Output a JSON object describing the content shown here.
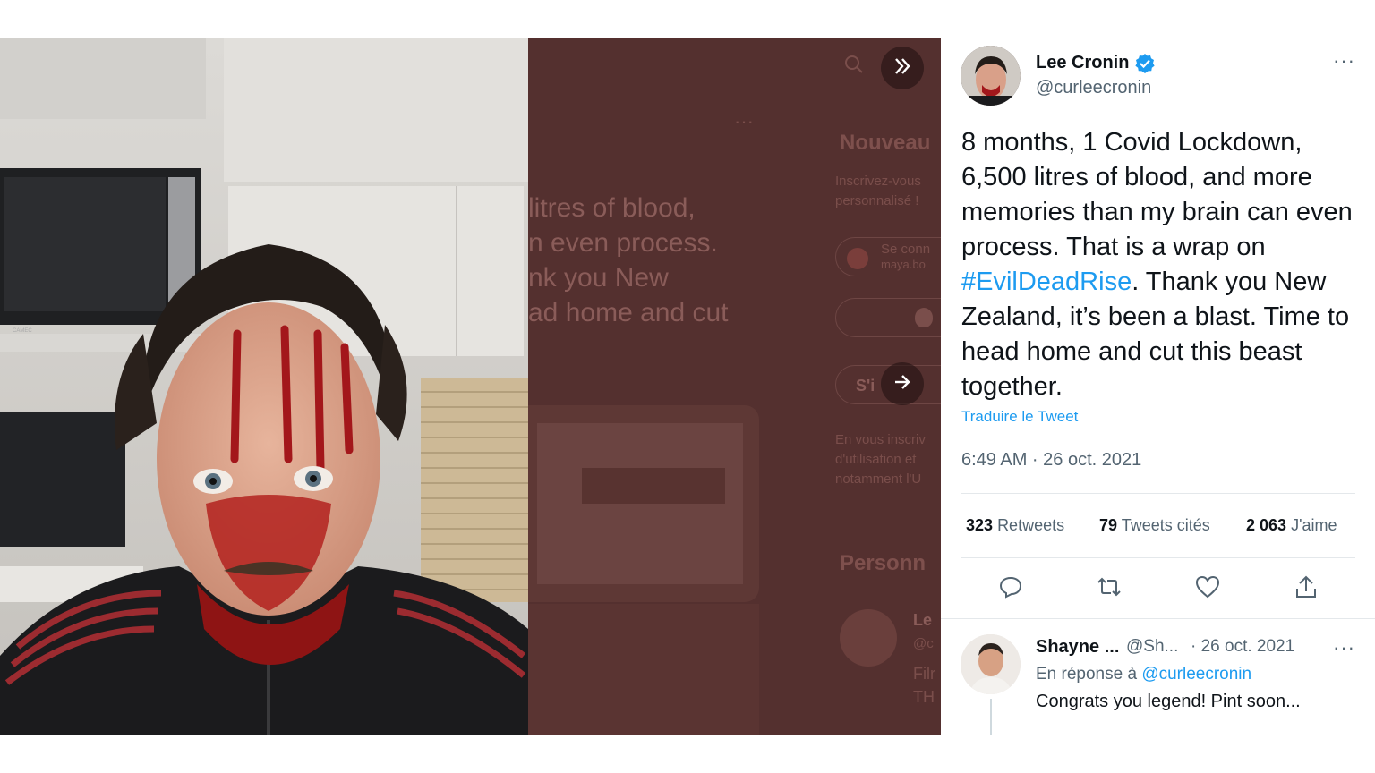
{
  "viewer": {
    "ghost_texts": [
      "litres of blood,",
      "n even process.",
      "nk you New",
      "ad home and cut"
    ],
    "ghost_heading_1": "Nouveau",
    "ghost_signup_1": "Inscrivez-vous",
    "ghost_signup_2": "personnalisé !",
    "ghost_connect": "Se conn",
    "ghost_connect_sub": "maya.bo",
    "ghost_sign": "S'i",
    "ghost_terms_1": "En vous inscriv",
    "ghost_terms_2": "d'utilisation et",
    "ghost_terms_3": "notamment l'U",
    "ghost_heading_2": "Personn",
    "ghost_profile_name": "Le",
    "ghost_profile_handle": "@c",
    "ghost_profile_bio_1": "Filr",
    "ghost_profile_bio_2": "TH",
    "ghost_dots": "···",
    "icons": {
      "collapse": "double-chevron-right-icon",
      "next": "arrow-right-icon",
      "search": "search-icon"
    }
  },
  "tweet": {
    "author_name": "Lee Cronin",
    "author_handle": "@curleecronin",
    "more": "···",
    "text_before": "8 months, 1 Covid Lockdown, 6,500 litres of blood, and more memories than my brain can even process. That is a wrap on ",
    "hashtag": "#EvilDeadRise",
    "text_after": ". Thank you New Zealand, it’s been a blast. Time to head home and cut this beast together.",
    "translate_label": "Traduire le Tweet",
    "timestamp": "6:49 AM · 26 oct. 2021",
    "stats": {
      "retweets_count": "323",
      "retweets_label": "Retweets",
      "quotes_count": "79",
      "quotes_label": "Tweets cités",
      "likes_count": "2 063",
      "likes_label": "J'aime"
    },
    "accent_color": "#1d9bf0"
  },
  "reply": {
    "author_name": "Shayne ...",
    "author_handle": "@Sh...",
    "date": "· 26 oct. 2021",
    "more": "···",
    "in_reply_prefix": "En réponse à",
    "in_reply_handle": "@curleecronin",
    "text": "Congrats you legend! Pint soon..."
  }
}
